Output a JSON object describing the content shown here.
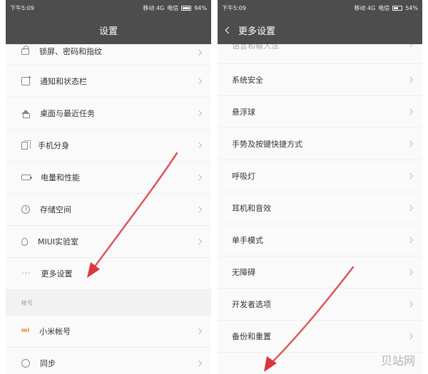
{
  "left": {
    "status": {
      "time": "下午5:09",
      "carrier": "移动 4G",
      "carrier2": "电信",
      "battery": "94%"
    },
    "title": "设置",
    "partial_top": "锁屏、密码和指纹",
    "items": [
      {
        "label": "通知和状态栏",
        "icon": "notification-icon"
      },
      {
        "label": "桌面与最近任务",
        "icon": "home-icon"
      },
      {
        "label": "手机分身",
        "icon": "clone-icon"
      },
      {
        "label": "电量和性能",
        "icon": "battery-icon"
      },
      {
        "label": "存储空间",
        "icon": "storage-icon"
      },
      {
        "label": "MIUI实验室",
        "icon": "lab-icon"
      },
      {
        "label": "更多设置",
        "icon": "more-icon"
      }
    ],
    "section_header": "帐号",
    "account_items": [
      {
        "label": "小米帐号",
        "icon": "mi-icon",
        "icon_text": "mi"
      },
      {
        "label": "同步",
        "icon": "sync-icon"
      }
    ]
  },
  "right": {
    "status": {
      "time": "下午5:09",
      "carrier": "移动 4G",
      "carrier2": "电信",
      "battery": "54%"
    },
    "title": "更多设置",
    "partial_top": "语言和输入法",
    "items": [
      {
        "label": "系统安全"
      },
      {
        "label": "悬浮球"
      },
      {
        "label": "手势及按键快捷方式"
      },
      {
        "label": "呼吸灯"
      },
      {
        "label": "耳机和音效"
      },
      {
        "label": "单手模式"
      },
      {
        "label": "无障碍"
      },
      {
        "label": "开发者选项"
      },
      {
        "label": "备份和重置"
      }
    ]
  },
  "watermark": "贝站网",
  "colors": {
    "bar": "#4d4d4d",
    "arrow": "#d9363e",
    "mi": "#e8800a"
  }
}
